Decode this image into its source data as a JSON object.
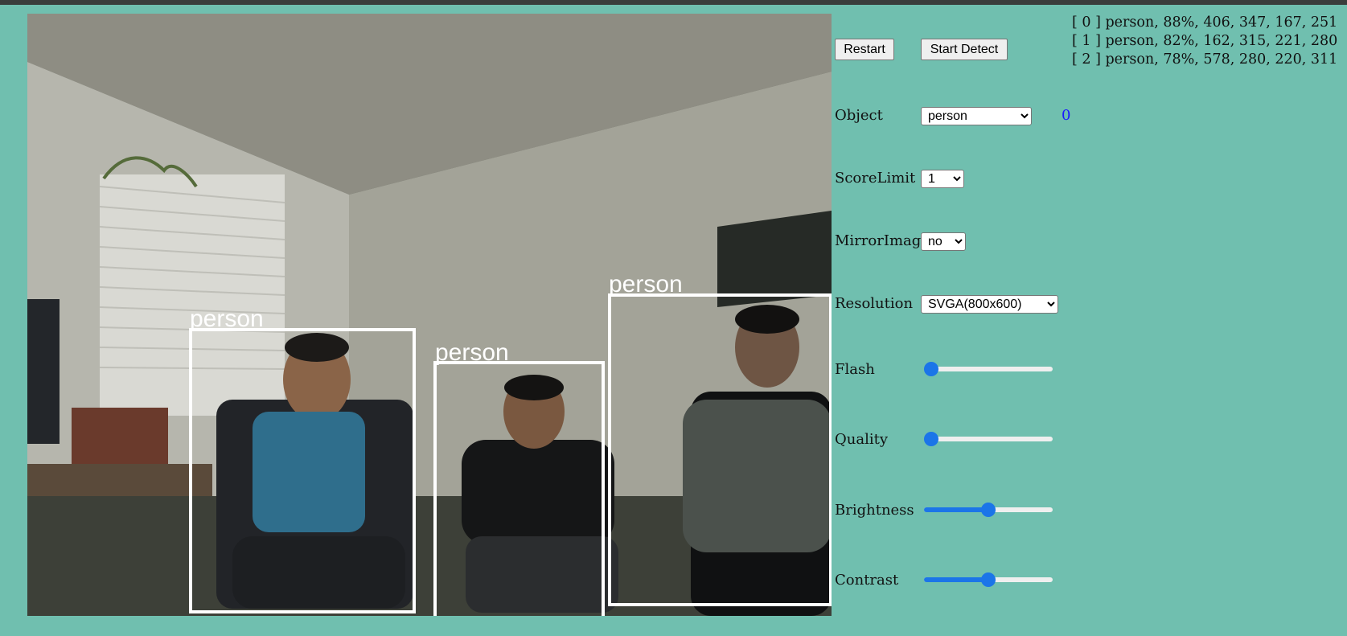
{
  "buttons": {
    "restart": "Restart",
    "start_detect": "Start Detect"
  },
  "results": [
    "[ 0 ] person, 88%, 406, 347, 167, 251",
    "[ 1 ] person, 82%, 162, 315, 221, 280",
    "[ 2 ] person, 78%, 578, 280, 220, 311"
  ],
  "detections": [
    "person",
    "person",
    "person"
  ],
  "controls": {
    "object": {
      "label": "Object",
      "value": "person",
      "count": "0"
    },
    "score_limit": {
      "label": "ScoreLimit",
      "value": "1"
    },
    "mirror_image": {
      "label": "MirrorImage",
      "value": "no"
    },
    "resolution": {
      "label": "Resolution",
      "value": "SVGA(800x600)"
    },
    "flash": {
      "label": "Flash",
      "level": 0.0
    },
    "quality": {
      "label": "Quality",
      "level": 0.0
    },
    "brightness": {
      "label": "Brightness",
      "level": 0.5
    },
    "contrast": {
      "label": "Contrast",
      "level": 0.5
    }
  },
  "colors": {
    "background": "#70bfaf",
    "slider": "#1b75e8",
    "count": "#1a1aff",
    "box": "#ffffff"
  }
}
